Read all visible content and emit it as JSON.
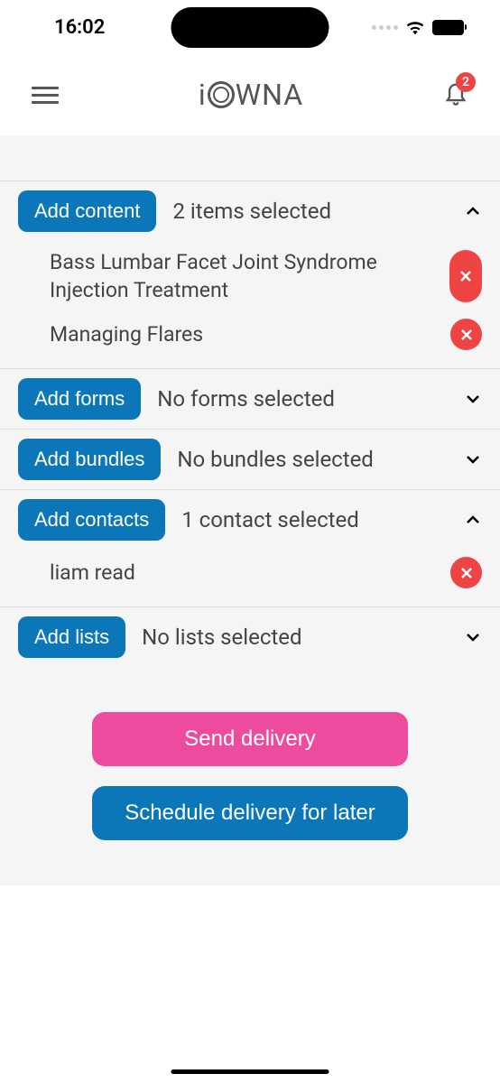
{
  "status": {
    "time": "16:02",
    "notification_count": "2"
  },
  "logo": {
    "text_prefix": "i",
    "text_suffix": "WNA"
  },
  "sections": {
    "content": {
      "button": "Add content",
      "status": "2 items selected",
      "items": [
        "Bass Lumbar Facet Joint Syndrome Injection Treatment",
        "Managing Flares"
      ]
    },
    "forms": {
      "button": "Add forms",
      "status": "No forms selected"
    },
    "bundles": {
      "button": "Add bundles",
      "status": "No bundles selected"
    },
    "contacts": {
      "button": "Add contacts",
      "status": "1 contact selected",
      "items": [
        "liam read"
      ]
    },
    "lists": {
      "button": "Add lists",
      "status": "No lists selected"
    }
  },
  "actions": {
    "send": "Send delivery",
    "schedule": "Schedule delivery for later"
  }
}
